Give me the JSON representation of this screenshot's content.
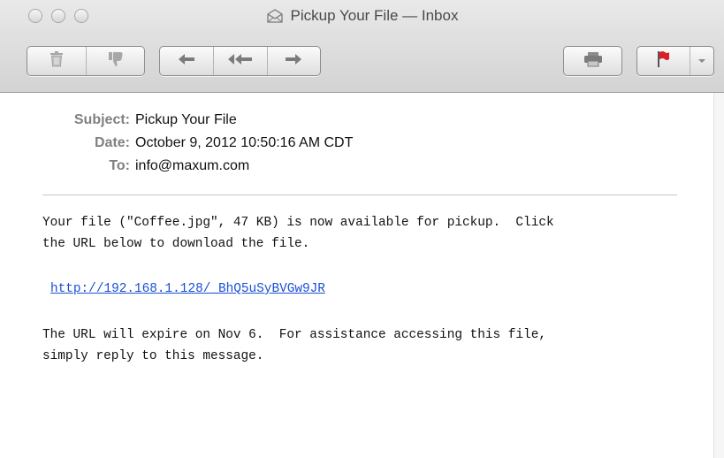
{
  "window": {
    "title": "Pickup Your File — Inbox"
  },
  "toolbar": {
    "icons": [
      "trash-icon",
      "junk-thumbs-down-icon",
      "reply-icon",
      "reply-all-icon",
      "forward-icon",
      "print-icon",
      "flag-icon",
      "chevron-down-icon"
    ],
    "flag_color": "#d81f26"
  },
  "message": {
    "headers": {
      "subject_label": "Subject:",
      "subject": "Pickup Your File",
      "date_label": "Date:",
      "date": "October 9, 2012 10:50:16 AM CDT",
      "to_label": "To:",
      "to": "info@maxum.com"
    },
    "body": {
      "line1": "Your file (\"Coffee.jpg\", 47 KB) is now available for pickup.  Click",
      "line2": "the URL below to download the file.",
      "link": "http://192.168.1.128/_BhQ5uSyBVGw9JR",
      "line3": "The URL will expire on Nov 6.  For assistance accessing this file,",
      "line4": "simply reply to this message."
    }
  }
}
